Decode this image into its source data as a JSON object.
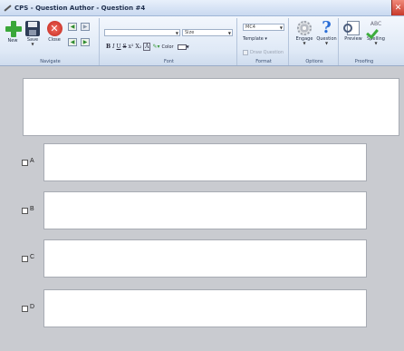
{
  "window": {
    "title": "CPS - Question Author - Question #4",
    "close_glyph": "✕"
  },
  "ribbon": {
    "navigate": {
      "label": "Navigate",
      "new_label": "New",
      "save_label": "Save",
      "close_label": "Close",
      "close_glyph": "✕",
      "prev_glyph": "◀",
      "next_glyph": "▶"
    },
    "font": {
      "label": "Font",
      "font_combo": "",
      "size_combo": "Size",
      "bold": "B",
      "italic": "I",
      "underline": "U",
      "strike": "S",
      "superscript": "x²",
      "subscript": "X₂",
      "color_label": "Color"
    },
    "format": {
      "label": "Format",
      "type_combo": "MC4",
      "template_label": "Template",
      "draw_question_label": "Draw Question"
    },
    "options": {
      "label": "Options",
      "engage_label": "Engage",
      "question_label": "Question"
    },
    "proofing": {
      "label": "Proofing",
      "preview_label": "Preview",
      "spelling_label": "Spelling",
      "spelling_text": "ABC"
    }
  },
  "question": {
    "text": ""
  },
  "answers": [
    {
      "letter": "A",
      "text": "",
      "checked": false
    },
    {
      "letter": "B",
      "text": "",
      "checked": false
    },
    {
      "letter": "C",
      "text": "",
      "checked": false
    },
    {
      "letter": "D",
      "text": "",
      "checked": false
    }
  ],
  "icons": {
    "new": "plus-icon",
    "save": "save-icon",
    "close": "close-icon",
    "engage": "gear-icon",
    "question": "question-icon",
    "preview": "preview-icon",
    "spelling": "spell-check-icon"
  }
}
